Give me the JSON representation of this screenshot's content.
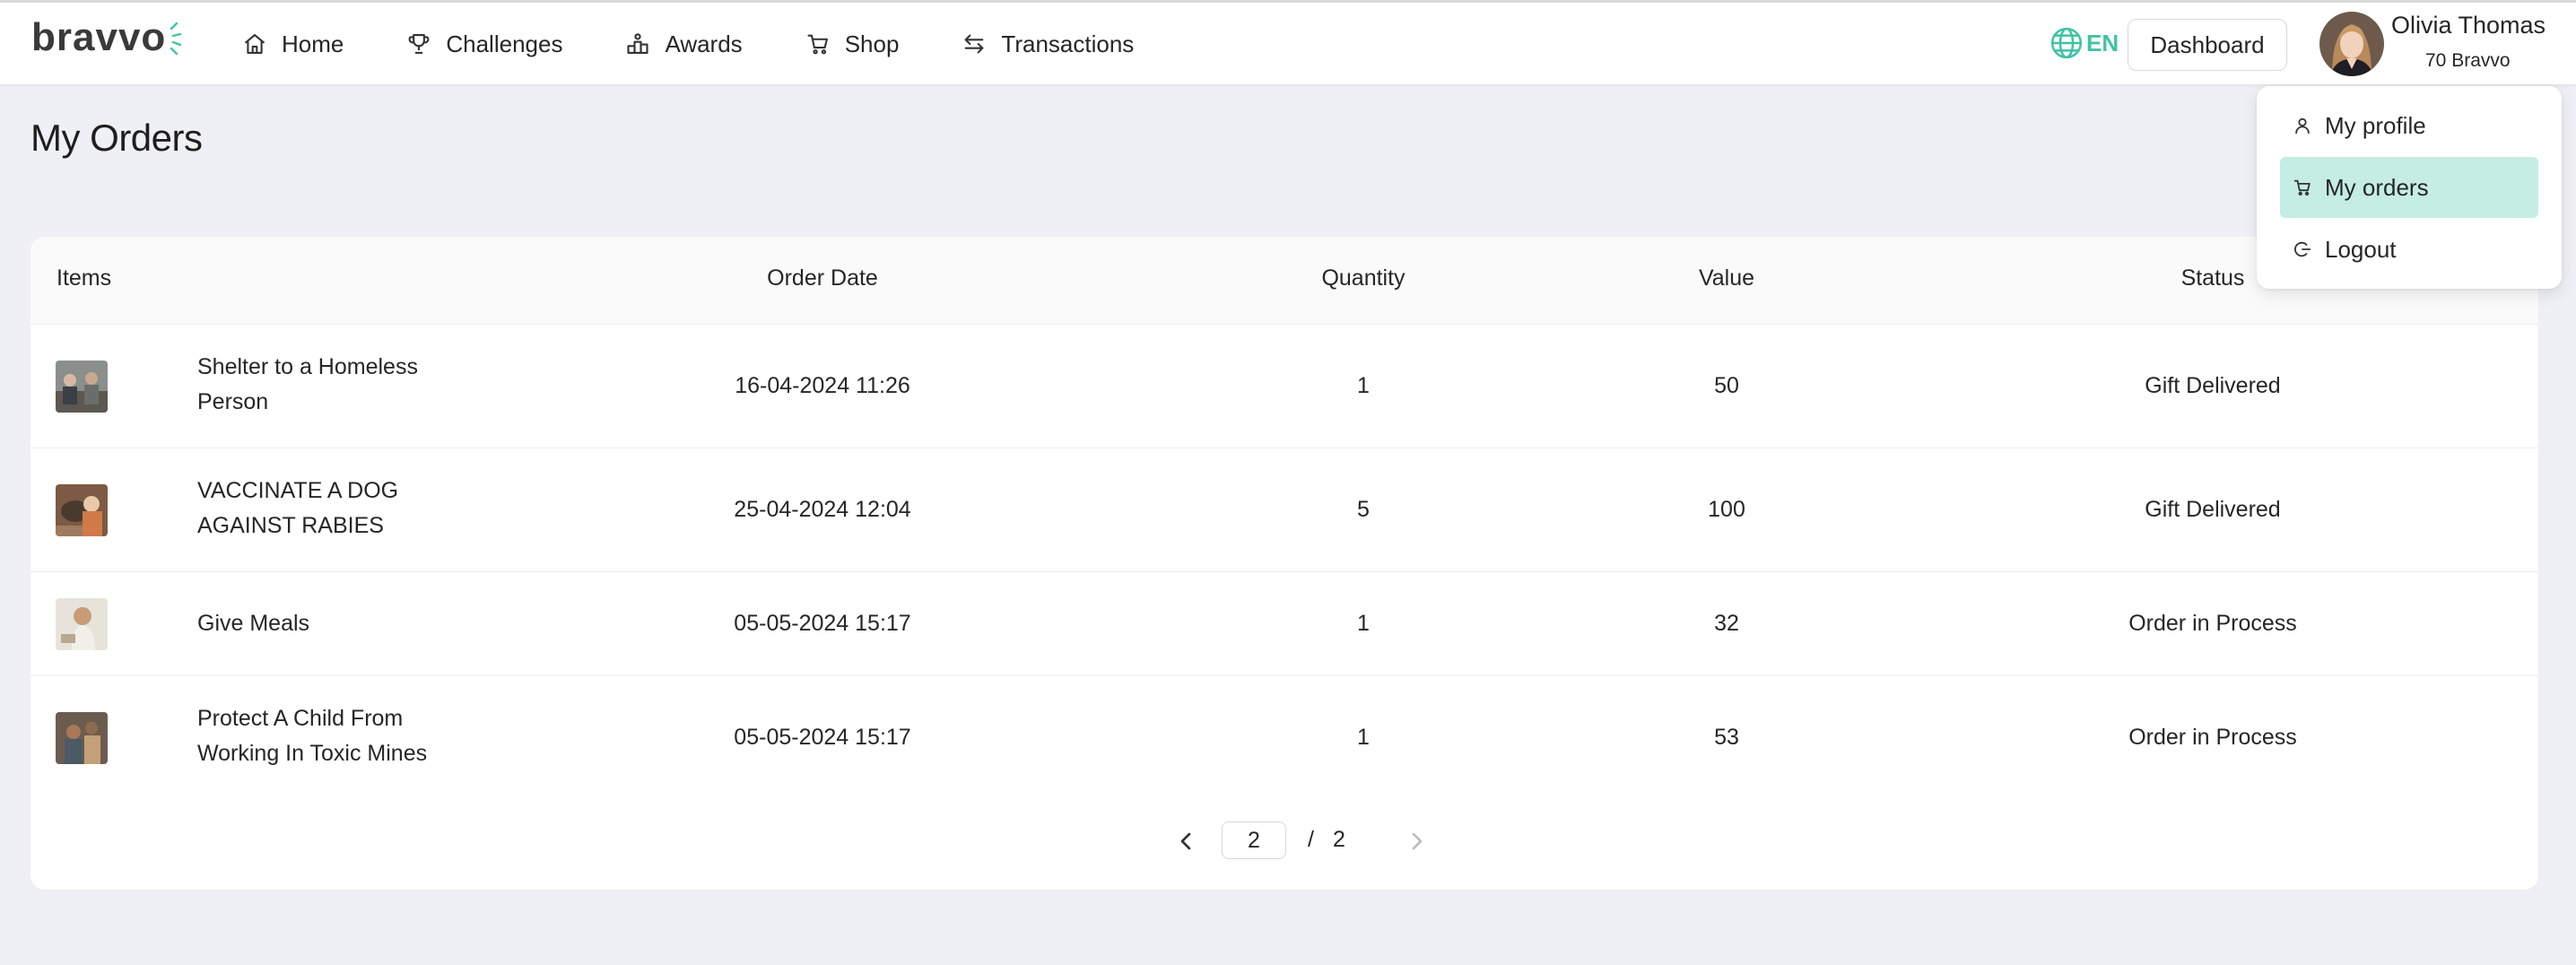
{
  "brand": {
    "logo_text": "bravvo",
    "accent_color": "#3fc3a4"
  },
  "nav": {
    "items": [
      {
        "label": "Home",
        "icon": "home-icon"
      },
      {
        "label": "Challenges",
        "icon": "trophy-icon"
      },
      {
        "label": "Awards",
        "icon": "podium-icon"
      },
      {
        "label": "Shop",
        "icon": "cart-icon"
      },
      {
        "label": "Transactions",
        "icon": "arrows-swap-icon"
      }
    ],
    "language": "EN",
    "dashboard_label": "Dashboard",
    "user": {
      "name": "Olivia Thomas",
      "points": "70 Bravvo"
    }
  },
  "page": {
    "title": "My Orders"
  },
  "table": {
    "columns": [
      "Items",
      "Order Date",
      "Quantity",
      "Value",
      "Status"
    ],
    "rows": [
      {
        "item_line1": "Shelter to a Homeless",
        "item_line2": "Person",
        "date": "16-04-2024 11:26",
        "quantity": "1",
        "value": "50",
        "status": "Gift Delivered"
      },
      {
        "item_line1": "VACCINATE A DOG",
        "item_line2": "AGAINST RABIES",
        "date": "25-04-2024 12:04",
        "quantity": "5",
        "value": "100",
        "status": "Gift Delivered"
      },
      {
        "item_line1": "Give Meals",
        "item_line2": "",
        "date": "05-05-2024 15:17",
        "quantity": "1",
        "value": "32",
        "status": "Order in Process"
      },
      {
        "item_line1": "Protect A Child From",
        "item_line2": "Working In Toxic Mines",
        "date": "05-05-2024 15:17",
        "quantity": "1",
        "value": "53",
        "status": "Order in Process"
      }
    ]
  },
  "pagination": {
    "current": "2",
    "separator": "/",
    "total": "2"
  },
  "user_menu": {
    "items": [
      {
        "label": "My profile",
        "icon": "user-icon"
      },
      {
        "label": "My orders",
        "icon": "cart-icon",
        "active": true
      },
      {
        "label": "Logout",
        "icon": "logout-icon"
      }
    ],
    "active_color": "#c5ede4"
  }
}
